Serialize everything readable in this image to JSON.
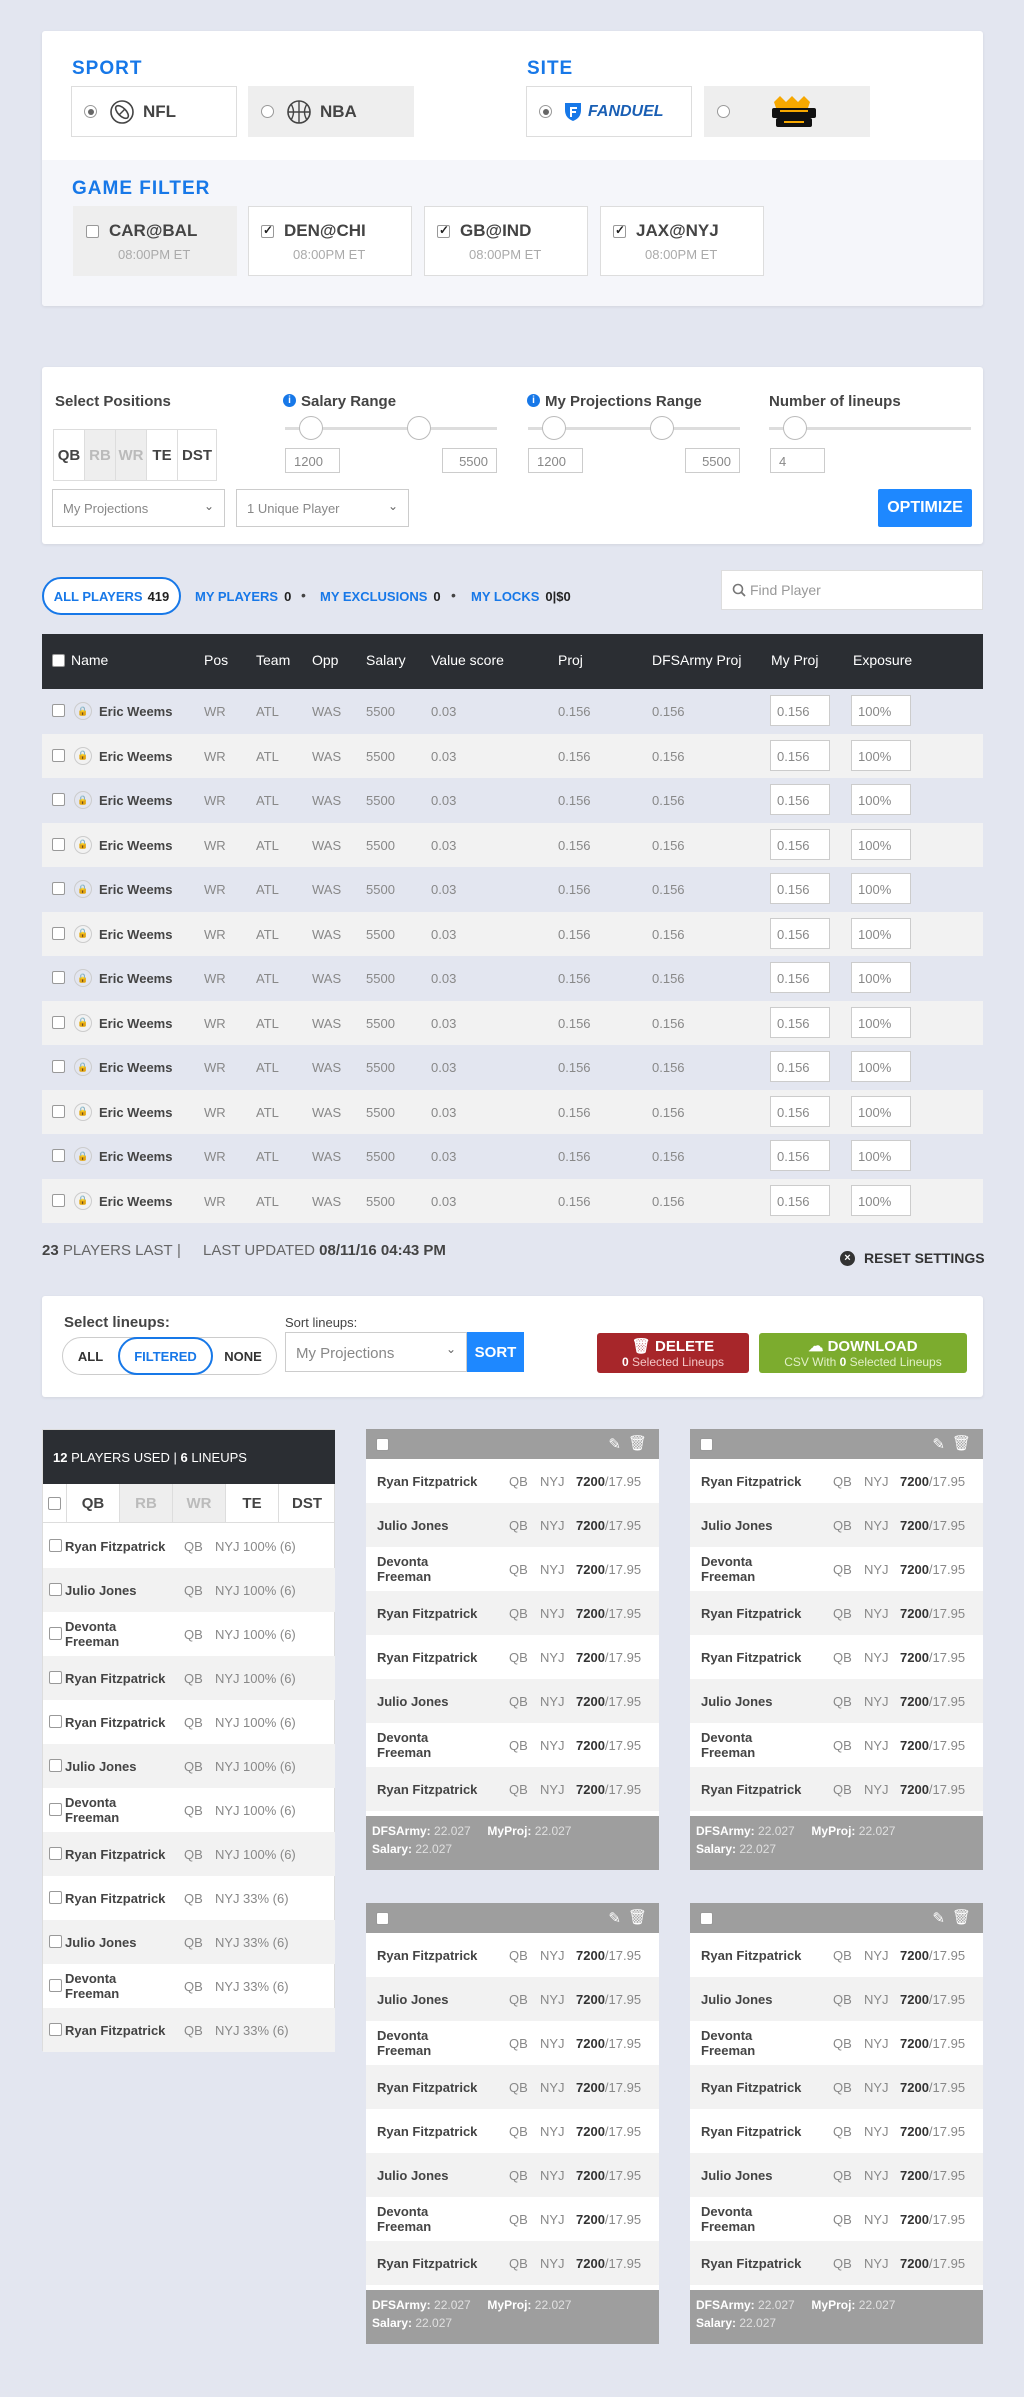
{
  "sport": {
    "title": "SPORT",
    "options": [
      {
        "label": "NFL",
        "selected": true,
        "icon": "football-icon"
      },
      {
        "label": "NBA",
        "selected": false,
        "icon": "basketball-icon"
      }
    ]
  },
  "site": {
    "title": "SITE",
    "options": [
      {
        "label": "FANDUEL",
        "selected": true,
        "icon": "fanduel-logo"
      },
      {
        "label": "",
        "selected": false,
        "icon": "draftkings-logo"
      }
    ]
  },
  "game_filter": {
    "title": "GAME FILTER",
    "games": [
      {
        "name": "CAR@BAL",
        "time": "08:00PM ET",
        "checked": false
      },
      {
        "name": "DEN@CHI",
        "time": "08:00PM ET",
        "checked": true
      },
      {
        "name": "GB@IND",
        "time": "08:00PM ET",
        "checked": true
      },
      {
        "name": "JAX@NYJ",
        "time": "08:00PM ET",
        "checked": true
      }
    ]
  },
  "controls": {
    "positions_label": "Select Positions",
    "positions": [
      "QB",
      "RB",
      "WR",
      "TE",
      "DST"
    ],
    "salary_label": "Salary Range",
    "salary_min": "1200",
    "salary_max": "5500",
    "proj_label": "My Projections Range",
    "proj_min": "1200",
    "proj_max": "5500",
    "lineups_label": "Number of lineups",
    "lineups_value": "4",
    "projection_select": "My Projections",
    "unique_select": "1 Unique Player",
    "optimize": "OPTIMIZE"
  },
  "tabs": {
    "all_players": "ALL PLAYERS",
    "all_count": "419",
    "my_players": "MY PLAYERS",
    "my_players_count": "0",
    "my_exclusions": "MY EXCLUSIONS",
    "my_exclusions_count": "0",
    "my_locks": "MY LOCKS",
    "my_locks_count": "0|$0",
    "search_placeholder": "Find Player"
  },
  "table": {
    "headers": [
      "Name",
      "Pos",
      "Team",
      "Opp",
      "Salary",
      "Value score",
      "Proj",
      "DFSArmy Proj",
      "My Proj",
      "Exposure"
    ],
    "row": {
      "name": "Eric Weems",
      "pos": "WR",
      "team": "ATL",
      "opp": "WAS",
      "salary": "5500",
      "value": "0.03",
      "proj": "0.156",
      "dfs": "0.156",
      "myproj": "0.156",
      "exposure": "100%"
    }
  },
  "footer": {
    "count": "23",
    "count_label": "PLAYERS LAST",
    "sep": "|",
    "updated_label": "LAST UPDATED",
    "updated": "08/11/16 04:43 PM",
    "reset": "RESET SETTINGS"
  },
  "lineups": {
    "select_label": "Select lineups:",
    "filters": [
      "ALL",
      "FILTERED",
      "NONE"
    ],
    "sort_label": "Sort lineups:",
    "sort_select": "My Projections",
    "sort_btn": "SORT",
    "delete": "DELETE",
    "delete_sub_count": "0",
    "delete_sub": "Selected Lineups",
    "download": "DOWNLOAD",
    "download_sub_pre": "CSV With",
    "download_sub_count": "0",
    "download_sub": "Selected Lineups"
  },
  "used": {
    "players": "12",
    "players_label": "PLAYERS USED",
    "lineups": "6",
    "lineups_label": "LINEUPS",
    "positions": [
      "QB",
      "RB",
      "WR",
      "TE",
      "DST"
    ]
  },
  "used_rows": [
    {
      "name": "Ryan Fitzpatrick",
      "pos": "QB",
      "team": "NYJ",
      "pct": "100% (6)"
    },
    {
      "name": "Julio Jones",
      "pos": "QB",
      "team": "NYJ",
      "pct": "100% (6)"
    },
    {
      "name": "Devonta Freeman",
      "pos": "QB",
      "team": "NYJ",
      "pct": "100% (6)"
    },
    {
      "name": "Ryan Fitzpatrick",
      "pos": "QB",
      "team": "NYJ",
      "pct": "100% (6)"
    },
    {
      "name": "Ryan Fitzpatrick",
      "pos": "QB",
      "team": "NYJ",
      "pct": "100% (6)"
    },
    {
      "name": "Julio Jones",
      "pos": "QB",
      "team": "NYJ",
      "pct": "100% (6)"
    },
    {
      "name": "Devonta Freeman",
      "pos": "QB",
      "team": "NYJ",
      "pct": "100% (6)"
    },
    {
      "name": "Ryan Fitzpatrick",
      "pos": "QB",
      "team": "NYJ",
      "pct": "100% (6)"
    },
    {
      "name": "Ryan Fitzpatrick",
      "pos": "QB",
      "team": "NYJ",
      "pct": "33% (6)"
    },
    {
      "name": "Julio Jones",
      "pos": "QB",
      "team": "NYJ",
      "pct": "33% (6)"
    },
    {
      "name": "Devonta Freeman",
      "pos": "QB",
      "team": "NYJ",
      "pct": "33% (6)"
    },
    {
      "name": "Ryan Fitzpatrick",
      "pos": "QB",
      "team": "NYJ",
      "pct": "33% (6)"
    }
  ],
  "lineup_card": {
    "rows": [
      {
        "name": "Ryan Fitzpatrick",
        "pos": "QB",
        "team": "NYJ",
        "salary": "7200",
        "proj": "17.95"
      },
      {
        "name": "Julio Jones",
        "pos": "QB",
        "team": "NYJ",
        "salary": "7200",
        "proj": "17.95"
      },
      {
        "name": "Devonta Freeman",
        "pos": "QB",
        "team": "NYJ",
        "salary": "7200",
        "proj": "17.95"
      },
      {
        "name": "Ryan Fitzpatrick",
        "pos": "QB",
        "team": "NYJ",
        "salary": "7200",
        "proj": "17.95"
      },
      {
        "name": "Ryan Fitzpatrick",
        "pos": "QB",
        "team": "NYJ",
        "salary": "7200",
        "proj": "17.95"
      },
      {
        "name": "Julio Jones",
        "pos": "QB",
        "team": "NYJ",
        "salary": "7200",
        "proj": "17.95"
      },
      {
        "name": "Devonta Freeman",
        "pos": "QB",
        "team": "NYJ",
        "salary": "7200",
        "proj": "17.95"
      },
      {
        "name": "Ryan Fitzpatrick",
        "pos": "QB",
        "team": "NYJ",
        "salary": "7200",
        "proj": "17.95"
      }
    ],
    "dfs_label": "DFSArmy:",
    "dfs_value": "22.027",
    "myproj_label": "MyProj:",
    "myproj_value": "22.027",
    "salary_label": "Salary:",
    "salary_value": "22.027"
  }
}
